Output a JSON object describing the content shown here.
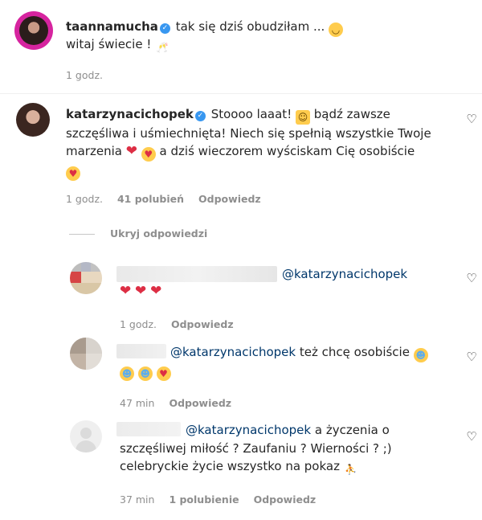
{
  "post": {
    "username": "taannamucha",
    "caption_line1": "tak się dziś obudziłam ...",
    "caption_line2": "witaj świecie !",
    "time": "1 godz."
  },
  "comment1": {
    "username": "katarzynacichopek",
    "line1": "Stoooo laaat!",
    "line1b": "bądź zawsze",
    "line2": "szczęśliwa i uśmiechnięta! Niech się spełnią wszystkie Twoje",
    "line3a": "marzenia",
    "line3b": "a dziś wieczorem wyściskam Cię osobiście",
    "time": "1 godz.",
    "likes": "41 polubień",
    "reply": "Odpowiedz"
  },
  "hide_replies": "Ukryj odpowiedzi",
  "reply1": {
    "mention": "@katarzynacichopek",
    "time": "1 godz.",
    "reply": "Odpowiedz"
  },
  "reply2": {
    "mention": "@katarzynacichopek",
    "text": "też chcę osobiście",
    "time": "47 min",
    "reply": "Odpowiedz"
  },
  "reply3": {
    "mention": "@katarzynacichopek",
    "line1": "a życzenia o",
    "line2": "szczęśliwej miłość ? Zaufaniu ? Wierności ? ;)",
    "line3": "celebryckie życie wszystko na pokaz",
    "time": "37 min",
    "likes": "1 polubienie",
    "reply": "Odpowiedz"
  },
  "colors": {
    "mention": "#00376b",
    "meta": "#8e8e8e",
    "verified": "#3897f0",
    "heart": "#dd2e44"
  }
}
